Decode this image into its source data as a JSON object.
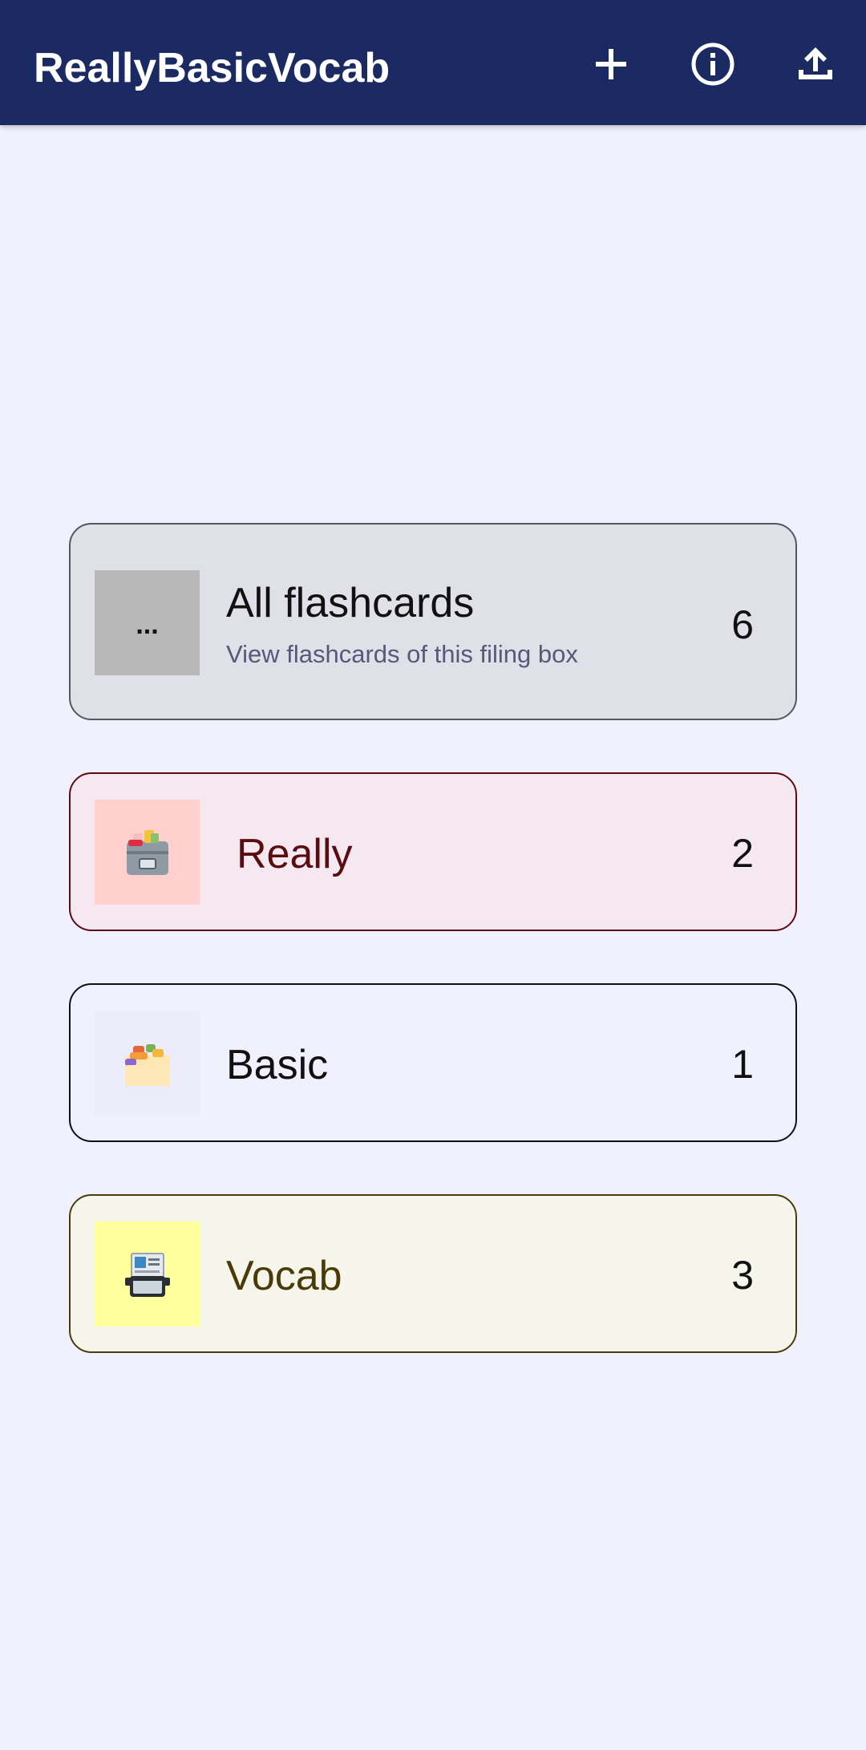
{
  "app": {
    "title": "ReallyBasicVocab"
  },
  "toolbar": {
    "add_icon": "plus-icon",
    "info_icon": "info-icon",
    "export_icon": "upload-icon"
  },
  "cards": [
    {
      "title": "All flashcards",
      "subtitle": "View flashcards of this filing box",
      "count": "6",
      "thumb_text": "...",
      "thumb_color": "#b7b7b7",
      "bg": "#e0e0e8",
      "border": "#55575f",
      "title_color": "#111111"
    },
    {
      "title": "Really",
      "count": "2",
      "icon": "card-file-box-icon",
      "thumb_color": "#ffd0cd",
      "bg": "#f6e8f1",
      "border": "#5c0b14",
      "title_color": "#5a0d10"
    },
    {
      "title": "Basic",
      "count": "1",
      "icon": "card-index-dividers-icon",
      "thumb_color": "#ececfb",
      "bg": "#f1f1fd",
      "border": "#101018",
      "title_color": "#111111"
    },
    {
      "title": "Vocab",
      "count": "3",
      "icon": "rolodex-icon",
      "thumb_color": "#ffff9e",
      "bg": "#f5f5ec",
      "border": "#4a3c0a",
      "title_color": "#4a3a06"
    }
  ]
}
